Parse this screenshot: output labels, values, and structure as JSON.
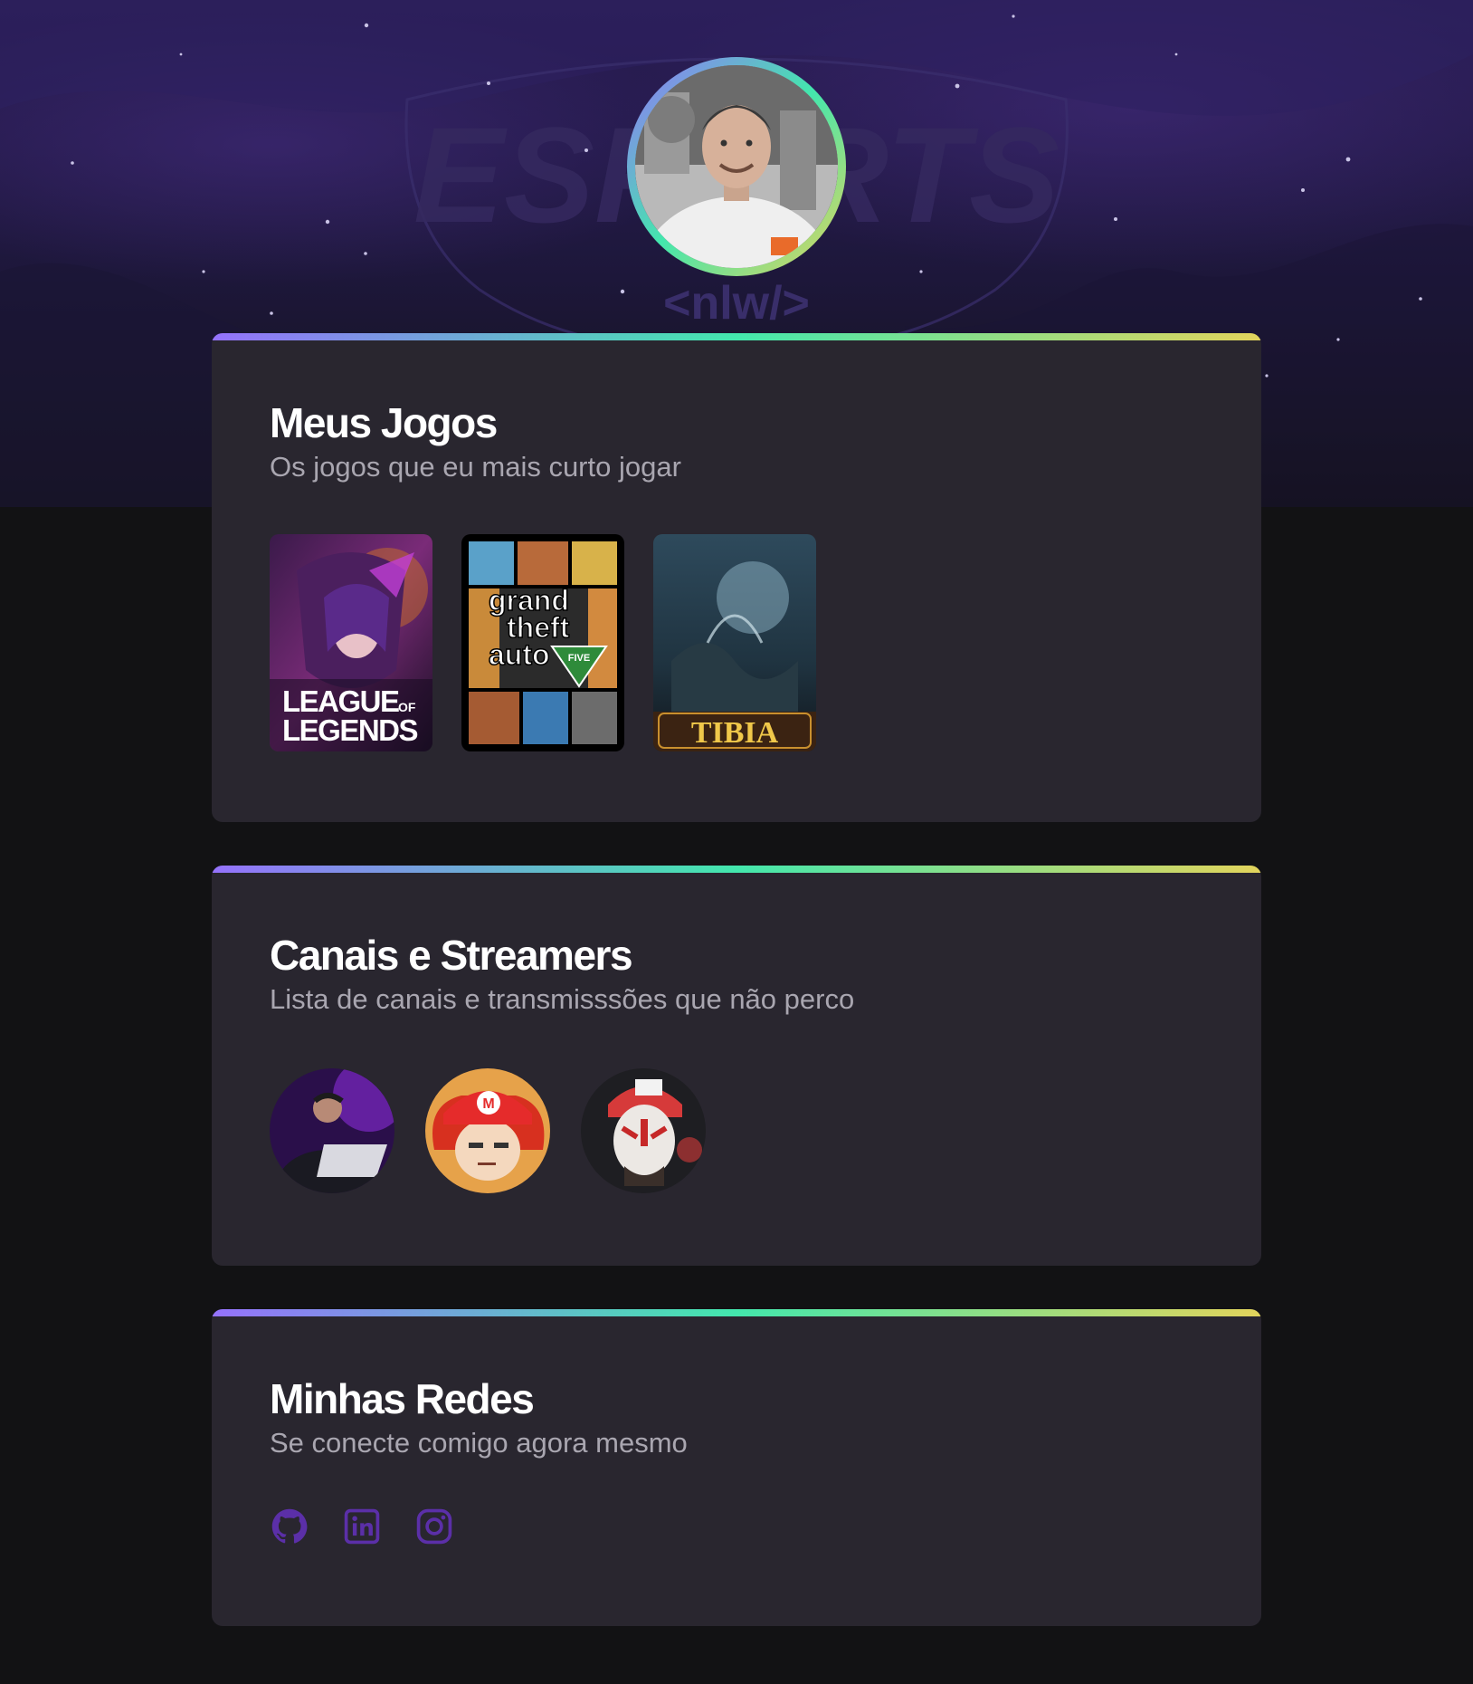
{
  "profile": {
    "avatar_alt": "Foto de perfil"
  },
  "banner": {
    "logo_text": "ESPORTS",
    "tag_text": "<nlw/>"
  },
  "accent_gradient": [
    "#9572fc",
    "#43e7ad",
    "#e2d45c"
  ],
  "sections": {
    "games": {
      "title": "Meus Jogos",
      "subtitle": "Os jogos que eu mais curto jogar",
      "items": [
        {
          "name": "League of Legends",
          "cover_text_1": "LEAGUE",
          "cover_text_of": "OF",
          "cover_text_2": "LEGENDS"
        },
        {
          "name": "Grand Theft Auto V",
          "cover_text_1": "grand",
          "cover_text_2": "theft",
          "cover_text_3": "auto",
          "cover_text_4": "FIVE"
        },
        {
          "name": "Tibia",
          "cover_text_1": "TIBIA"
        }
      ]
    },
    "streamers": {
      "title": "Canais e Streamers",
      "subtitle": "Lista de canais e transmisssões que não perco",
      "items": [
        {
          "icon": "streamer-laptop-avatar"
        },
        {
          "icon": "streamer-red-cap-avatar"
        },
        {
          "icon": "streamer-facepaint-avatar"
        }
      ]
    },
    "socials": {
      "title": "Minhas Redes",
      "subtitle": "Se conecte comigo agora mesmo",
      "icon_color": "#5b2fa8",
      "items": [
        {
          "icon": "github-icon"
        },
        {
          "icon": "linkedin-icon"
        },
        {
          "icon": "instagram-icon"
        }
      ]
    }
  }
}
